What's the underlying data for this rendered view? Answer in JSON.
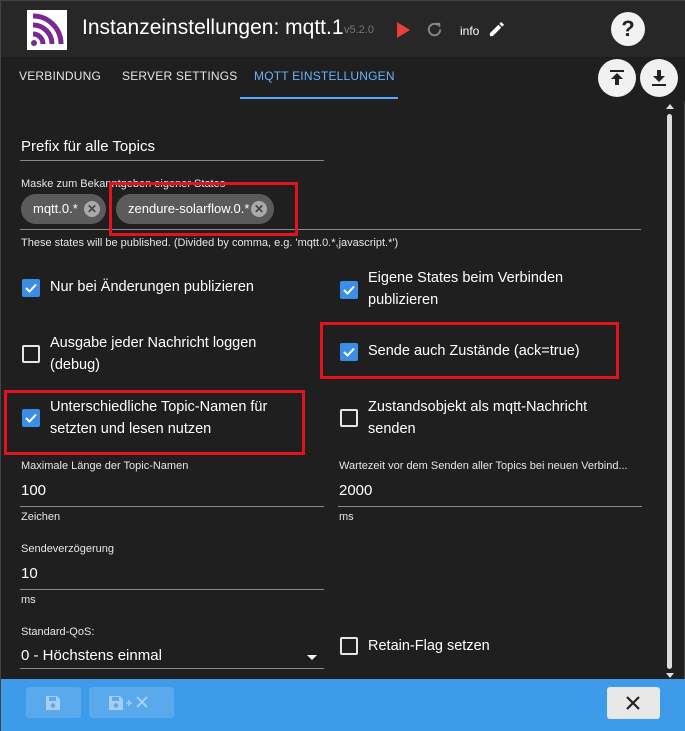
{
  "header": {
    "title": "Instanzeinstellungen: mqtt.1",
    "version": "v5.2.0",
    "info_label": "info",
    "help_label": "?"
  },
  "tabs": [
    {
      "label": "VERBINDUNG"
    },
    {
      "label": "SERVER SETTINGS"
    },
    {
      "label": "MQTT EINSTELLUNGEN"
    }
  ],
  "prefix": {
    "label": "Prefix für alle Topics"
  },
  "mask": {
    "label": "Maske zum Bekanntgeben eigener States",
    "chips": [
      "mqtt.0.*",
      "zendure-solarflow.0.*"
    ],
    "helper": "These states will be published. (Divided by comma, e.g. 'mqtt.0.*,javascript.*')"
  },
  "options": {
    "only_changes": {
      "label": "Nur bei Änderungen publizieren",
      "checked": true
    },
    "own_states": {
      "label": "Eigene States beim Verbinden publizieren",
      "checked": true
    },
    "log_messages": {
      "label": "Ausgabe jeder Nachricht loggen (debug)",
      "checked": false
    },
    "send_ack": {
      "label": "Sende auch Zustände (ack=true)",
      "checked": true
    },
    "different_topics": {
      "label": "Unterschiedliche Topic-Namen für setzten und lesen nutzen",
      "checked": true
    },
    "state_object": {
      "label": "Zustandsobjekt als mqtt-Nachricht senden",
      "checked": false
    },
    "retain": {
      "label": "Retain-Flag setzen",
      "checked": false
    }
  },
  "fields": {
    "max_len": {
      "label": "Maximale Länge der Topic-Namen",
      "value": "100",
      "unit": "Zeichen"
    },
    "wait": {
      "label": "Wartezeit vor dem Senden aller Topics bei neuen Verbind...",
      "value": "2000",
      "unit": "ms"
    },
    "send_delay": {
      "label": "Sendeverzögerung",
      "value": "10",
      "unit": "ms"
    },
    "qos": {
      "label": "Standard-QoS:",
      "value": "0 - Höchstens einmal"
    }
  },
  "colors": {
    "accent": "#3d9be9",
    "tab_active": "#6ab1ff",
    "highlight": "#e0141d",
    "background": "#1f1f1f"
  },
  "icons": [
    "logo-icon",
    "play-icon",
    "reload-icon",
    "pencil-icon",
    "help-icon",
    "upload-icon",
    "download-icon",
    "chip-remove-icon",
    "checkmark-icon",
    "dropdown-arrow-icon",
    "save-icon",
    "save-close-icon",
    "close-icon"
  ]
}
